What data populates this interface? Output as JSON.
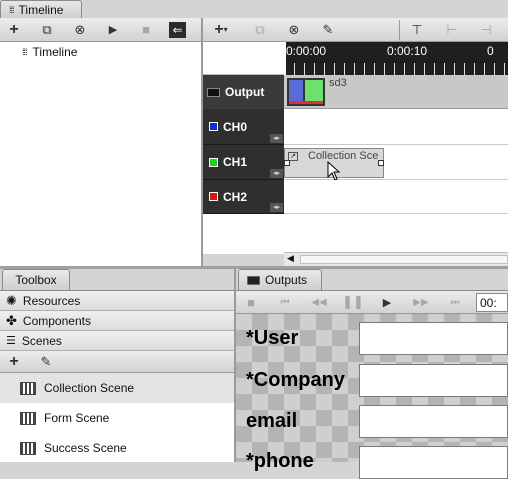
{
  "timeline_panel": {
    "tab_label": "Timeline",
    "tree_item": "Timeline"
  },
  "timeline": {
    "time_marks": [
      "0:00:00",
      "0:00:10",
      "0"
    ],
    "output_label": "Output",
    "output_clip_name": "sd3",
    "channels": [
      {
        "label": "CH0",
        "color": "#1030e0"
      },
      {
        "label": "CH1",
        "color": "#20d020"
      },
      {
        "label": "CH2",
        "color": "#e01010"
      }
    ],
    "clip_label": "Collection Sce"
  },
  "toolbox": {
    "tab_label": "Toolbox",
    "sections": [
      "Resources",
      "Components",
      "Scenes"
    ],
    "scenes": [
      "Collection Scene",
      "Form Scene",
      "Success Scene"
    ]
  },
  "outputs": {
    "tab_label": "Outputs",
    "timecode": "00:",
    "fields": [
      "*User",
      "*Company",
      "email",
      "*phone"
    ]
  }
}
